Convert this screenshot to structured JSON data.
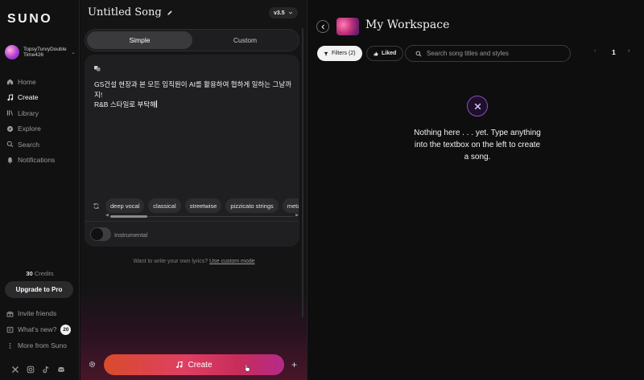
{
  "app": {
    "logo": "SUNO"
  },
  "user": {
    "name": "TopsyTurvyDoubleTime426"
  },
  "nav": [
    {
      "label": "Home",
      "icon": "home-icon"
    },
    {
      "label": "Create",
      "icon": "music-note-icon",
      "active": true
    },
    {
      "label": "Library",
      "icon": "library-icon"
    },
    {
      "label": "Explore",
      "icon": "compass-icon"
    },
    {
      "label": "Search",
      "icon": "search-icon"
    },
    {
      "label": "Notifications",
      "icon": "bell-icon"
    }
  ],
  "credits": {
    "count": "30",
    "label": "Credits"
  },
  "upgrade_label": "Upgrade to Pro",
  "bottom_nav": {
    "invite": "Invite friends",
    "whats_new": "What's new?",
    "whats_new_badge": "20",
    "more": "More from Suno"
  },
  "social": [
    "x-icon",
    "instagram-icon",
    "tiktok-icon",
    "discord-icon"
  ],
  "create": {
    "song_title": "Untitled Song",
    "version": "v3.5",
    "tabs": {
      "simple": "Simple",
      "custom": "Custom"
    },
    "prompt": "GS건설 현장과 본 모든 임직원이 AI를 활용하여 협하게 일하는 그날까지!\nR&B 스타일로 부탁해",
    "style_chips": [
      "deep vocal",
      "classical",
      "streetwise",
      "pizzicato strings",
      "metal"
    ],
    "instrumental_label": "Instrumental",
    "instrumental_on": false,
    "lyrics_hint": "Want to write your own lyrics?",
    "lyrics_link": "Use custom mode",
    "create_label": "Create"
  },
  "workspace": {
    "title": "My Workspace",
    "filters_label": "Filters (2)",
    "liked_label": "Liked",
    "search_placeholder": "Search song titles and styles",
    "page": "1",
    "empty_message": "Nothing here . . . yet. Type anything into the textbox on the left to create a song."
  },
  "colors": {
    "accent_gradient_start": "#d94b2b",
    "accent_gradient_end": "#b52a8a",
    "empty_icon": "#8c4cc8"
  }
}
